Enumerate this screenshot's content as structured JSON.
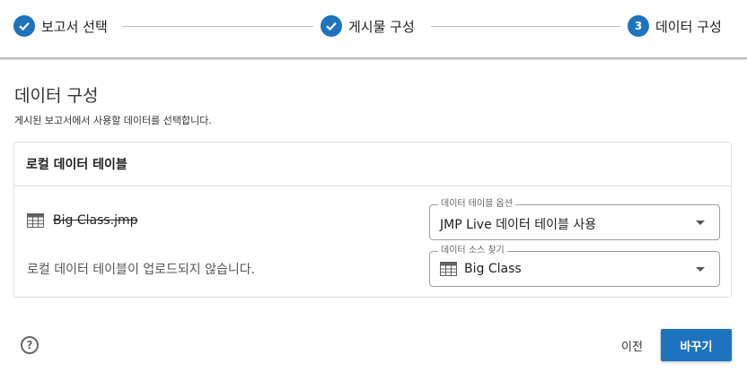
{
  "stepper": {
    "steps": [
      {
        "label": "보고서 선택",
        "state": "completed",
        "icon": "check-icon"
      },
      {
        "label": "게시물 구성",
        "state": "completed",
        "icon": "check-icon"
      },
      {
        "label": "데이터 구성",
        "state": "active",
        "number": "3"
      }
    ]
  },
  "page": {
    "title": "데이터 구성",
    "description": "게시된 보고서에서 사용할 데이터를 선택합니다."
  },
  "card": {
    "title": "로컬 데이터 테이블",
    "table_name": "Big Class.jmp",
    "status_text": "로컬 데이터 테이블이 업로드되지 않습니다.",
    "option_select": {
      "legend": "데이터 테이블 옵션",
      "value": "JMP Live 데이터 테이블 사용"
    },
    "source_select": {
      "legend": "데이터 소스 찾기",
      "value": "Big Class",
      "icon": "data-table-icon"
    }
  },
  "footer": {
    "help_glyph": "?",
    "prev_label": "이전",
    "submit_label": "바꾸기"
  },
  "colors": {
    "accent": "#1e73be"
  }
}
